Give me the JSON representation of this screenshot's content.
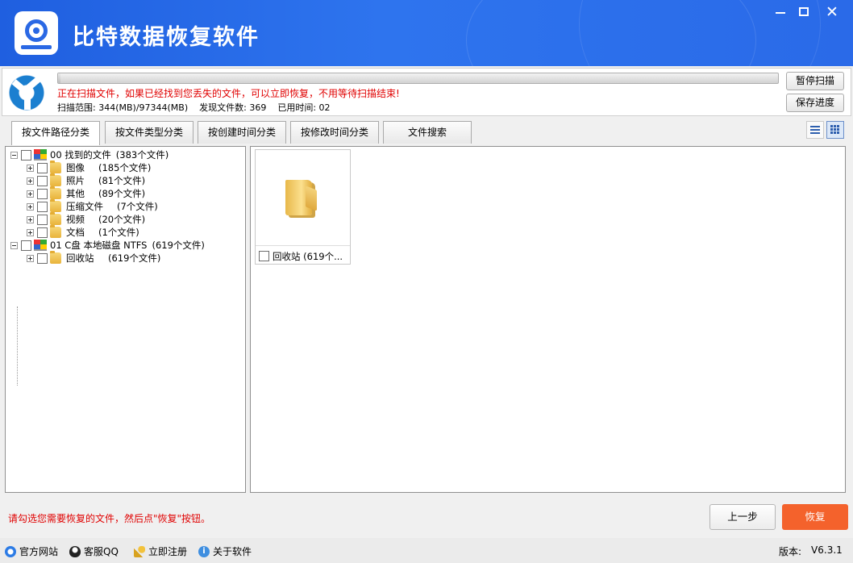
{
  "app": {
    "title": "比特数据恢复软件",
    "window_controls": {
      "minimize": "—",
      "maximize": "□",
      "close": "✕"
    }
  },
  "scan": {
    "progress_fraction": 0.0035,
    "message": "正在扫描文件，如果已经找到您丢失的文件，可以立即恢复，不用等待扫描结束!",
    "range_label": "扫描范围: 344(MB)/97344(MB)",
    "found_label": "发现文件数: 369",
    "elapsed_label": "已用时间: 02",
    "pause_button": "暂停扫描",
    "save_button": "保存进度"
  },
  "tabs": [
    {
      "label": "按文件路径分类",
      "active": true
    },
    {
      "label": "按文件类型分类",
      "active": false
    },
    {
      "label": "按创建时间分类",
      "active": false
    },
    {
      "label": "按修改时间分类",
      "active": false
    },
    {
      "label": "文件搜索",
      "active": false
    }
  ],
  "view_modes": {
    "list": "list-view-icon",
    "grid": "grid-view-icon",
    "selected": "grid"
  },
  "tree": {
    "roots": [
      {
        "label": "00 找到的文件",
        "count": "(383个文件)",
        "icon": "drive-icon",
        "children": [
          {
            "label": "图像",
            "count": "(185个文件)"
          },
          {
            "label": "照片",
            "count": "(81个文件)"
          },
          {
            "label": "其他",
            "count": "(89个文件)"
          },
          {
            "label": "压缩文件",
            "count": "(7个文件)"
          },
          {
            "label": "视频",
            "count": "(20个文件)"
          },
          {
            "label": "文档",
            "count": "(1个文件)"
          }
        ]
      },
      {
        "label": "01 C盘 本地磁盘 NTFS",
        "count": "(619个文件)",
        "icon": "drive-icon",
        "children": [
          {
            "label": "回收站",
            "count": "(619个文件)"
          }
        ]
      }
    ]
  },
  "file_view": {
    "items": [
      {
        "label": "回收站 (619个...",
        "icon": "folder-icon"
      }
    ]
  },
  "bottom": {
    "hint": "请勾选您需要恢复的文件，然后点\"恢复\"按钮。",
    "back_button": "上一步",
    "recover_button": "恢复"
  },
  "footer": {
    "links": [
      {
        "label": "官方网站",
        "icon": "ie-icon"
      },
      {
        "label": "客服QQ",
        "icon": "qq-icon"
      },
      {
        "label": "立即注册",
        "icon": "key-icon"
      },
      {
        "label": "关于软件",
        "icon": "info-icon"
      }
    ],
    "version_label": "版本:",
    "version_value": "V6.3.1"
  },
  "colors": {
    "title_bar": "#2a6ae8",
    "warning_text": "#e00000",
    "recover_button": "#f4622c"
  }
}
